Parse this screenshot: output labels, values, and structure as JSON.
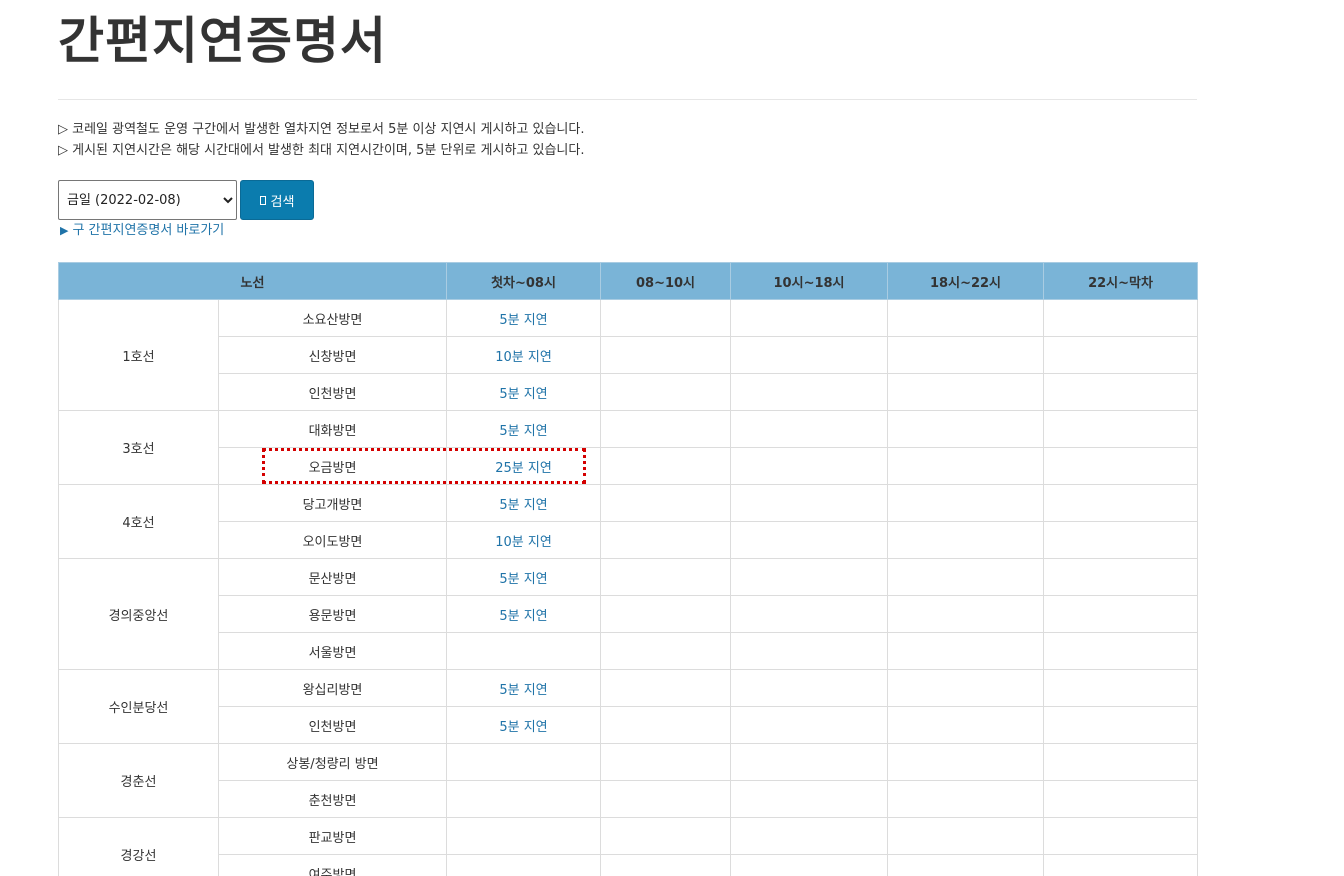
{
  "page": {
    "title": "간편지연증명서",
    "notices": [
      "▷ 코레일 광역철도 운영 구간에서 발생한 열차지연 정보로서 5분 이상 지연시 게시하고 있습니다.",
      "▷ 게시된 지연시간은 해당 시간대에서 발생한 최대 지연시간이며, 5분 단위로 게시하고 있습니다."
    ]
  },
  "search": {
    "selected_date": "금일 (2022-02-08)",
    "button_label": "검색",
    "old_link_arrow": "▶",
    "old_link_label": "구 간편지연증명서 바로가기"
  },
  "table": {
    "headers": [
      "노선",
      "첫차~08시",
      "08~10시",
      "10시~18시",
      "18시~22시",
      "22시~막차"
    ],
    "lines": [
      {
        "name": "1호선",
        "directions": [
          {
            "direction": "소요산방면",
            "delays": [
              "5분 지연",
              "",
              "",
              "",
              ""
            ]
          },
          {
            "direction": "신창방면",
            "delays": [
              "10분 지연",
              "",
              "",
              "",
              ""
            ]
          },
          {
            "direction": "인천방면",
            "delays": [
              "5분 지연",
              "",
              "",
              "",
              ""
            ]
          }
        ]
      },
      {
        "name": "3호선",
        "directions": [
          {
            "direction": "대화방면",
            "delays": [
              "5분 지연",
              "",
              "",
              "",
              ""
            ]
          },
          {
            "direction": "오금방면",
            "delays": [
              "25분 지연",
              "",
              "",
              "",
              ""
            ]
          }
        ]
      },
      {
        "name": "4호선",
        "directions": [
          {
            "direction": "당고개방면",
            "delays": [
              "5분 지연",
              "",
              "",
              "",
              ""
            ]
          },
          {
            "direction": "오이도방면",
            "delays": [
              "10분 지연",
              "",
              "",
              "",
              ""
            ]
          }
        ]
      },
      {
        "name": "경의중앙선",
        "directions": [
          {
            "direction": "문산방면",
            "delays": [
              "5분 지연",
              "",
              "",
              "",
              ""
            ]
          },
          {
            "direction": "용문방면",
            "delays": [
              "5분 지연",
              "",
              "",
              "",
              ""
            ]
          },
          {
            "direction": "서울방면",
            "delays": [
              "",
              "",
              "",
              "",
              ""
            ]
          }
        ]
      },
      {
        "name": "수인분당선",
        "directions": [
          {
            "direction": "왕십리방면",
            "delays": [
              "5분 지연",
              "",
              "",
              "",
              ""
            ]
          },
          {
            "direction": "인천방면",
            "delays": [
              "5분 지연",
              "",
              "",
              "",
              ""
            ]
          }
        ]
      },
      {
        "name": "경춘선",
        "directions": [
          {
            "direction": "상봉/청량리 방면",
            "delays": [
              "",
              "",
              "",
              "",
              ""
            ]
          },
          {
            "direction": "춘천방면",
            "delays": [
              "",
              "",
              "",
              "",
              ""
            ]
          }
        ]
      },
      {
        "name": "경강선",
        "directions": [
          {
            "direction": "판교방면",
            "delays": [
              "",
              "",
              "",
              "",
              ""
            ]
          },
          {
            "direction": "여주방면",
            "delays": [
              "",
              "",
              "",
              "",
              ""
            ]
          }
        ]
      }
    ]
  },
  "colors": {
    "header_bg": "#7ab4d7",
    "button_bg": "#0b7cae",
    "link_text": "#1f73a8",
    "highlight_border": "#d40000"
  }
}
